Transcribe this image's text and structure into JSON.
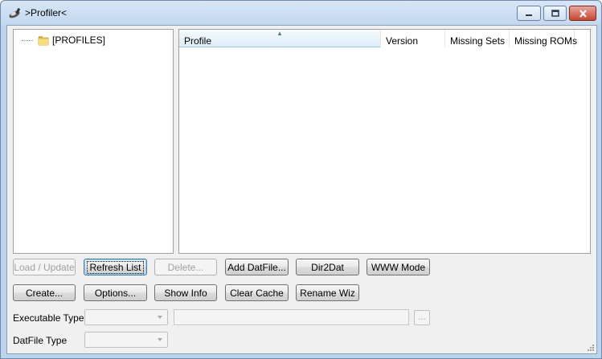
{
  "window": {
    "title": ">Profiler<",
    "accent": "#bcd3ec"
  },
  "tree": {
    "root_label": "[PROFILES]"
  },
  "list": {
    "columns": [
      "Profile",
      "Version",
      "Missing Sets",
      "Missing ROMs"
    ],
    "sorted_column": "Profile",
    "rows": []
  },
  "buttons": {
    "load_update": "Load / Update",
    "refresh_list": "Refresh List",
    "delete": "Delete...",
    "add_datfile": "Add DatFile...",
    "dir2dat": "Dir2Dat",
    "www_mode": "WWW Mode",
    "create": "Create...",
    "options": "Options...",
    "show_info": "Show Info",
    "clear_cache": "Clear Cache",
    "rename_wiz": "Rename Wiz",
    "browse": "..."
  },
  "fields": {
    "executable_type_label": "Executable Type",
    "datfile_type_label": "DatFile Type",
    "executable_type_value": "",
    "executable_path_value": "",
    "datfile_type_value": ""
  }
}
